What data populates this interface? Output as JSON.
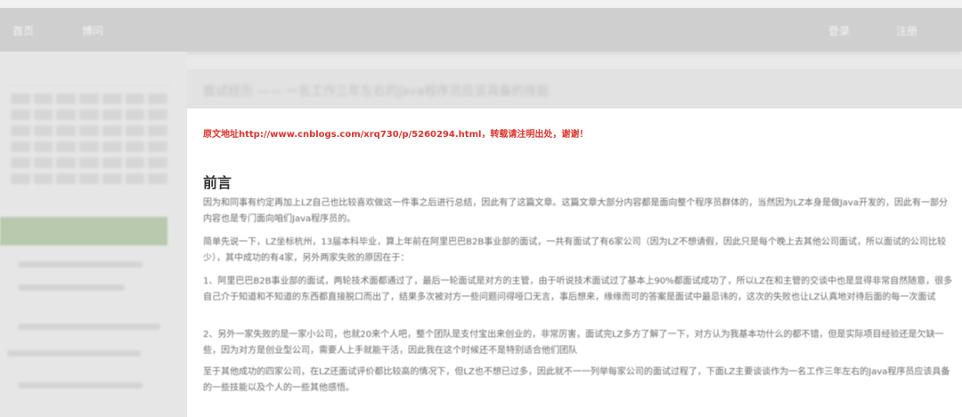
{
  "navbar": {
    "links": [
      "首页",
      "博问"
    ],
    "right_links": [
      "登录",
      "注册"
    ]
  },
  "article": {
    "title": "面试经历 —— 一名工作三年左右的Java程序员应该具备的技能",
    "source_label": "原文地址",
    "source_url": "http://www.cnblogs.com/xrq730/p/5260294.html",
    "source_note": "，转载请注明出处，谢谢！",
    "heading": "前言",
    "paragraphs": [
      "因为和同事有约定再加上LZ自己也比较喜欢做这一件事之后进行总结，因此有了这篇文章。这篇文章大部分内容都是面向整个程序员群体的，当然因为LZ本身是做Java开发的，因此有一部分内容也是专门面向咱们Java程序员的。",
      "简单先说一下，LZ坐标杭州，13届本科毕业，算上年前在阿里巴巴B2B事业部的面试，一共有面试了有6家公司（因为LZ不想请假，因此只是每个晚上去其他公司面试，所以面试的公司比较少），其中成功的有4家，另外两家失败的原因在于：",
      "1、阿里巴巴B2B事业部的面试，两轮技术面都通过了，最后一轮面试是对方的主管，由于听说技术面试过了基本上90%都面试成功了，所以LZ在和主管的交谈中也是显得非常自然随意，很多自己介于知道和不知道的东西都直接脱口而出了，结果多次被对方一些问题问得哑口无言，事后想来，缘缘而可的答案是面试中最忌讳的，这次的失败也让LZ认真地对待后面的每一次面试",
      "2、另外一家失败的是一家小公司，也就20来个人吧，整个团队是支付宝出来创业的，非常厉害，面试完LZ多方了解了一下，对方认为我基本功什么的都不错，但是实际项目经验还是欠缺一些，因为对方是创业型公司，需要人上手就能干活，因此我在这个时候还不是特别适合他们团队",
      "至于其他成功的四家公司，在LZ还面试评价都比较高的情况下，但LZ也不想已过多，因此就不一一列举每家公司的面试过程了，下面LZ主要谈谈作为一名工作三年左右的Java程序员应该具备的一些技能以及个人的一些其他感悟。"
    ]
  }
}
